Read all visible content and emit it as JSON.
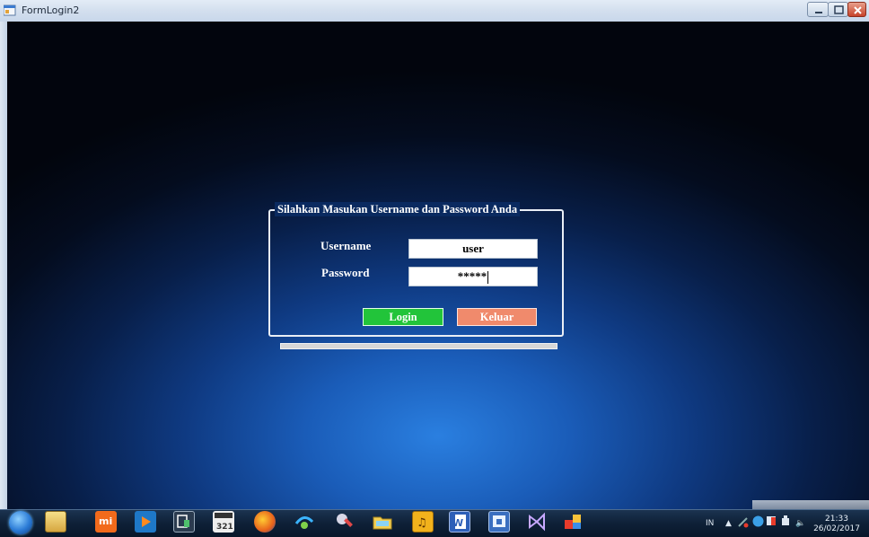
{
  "window": {
    "title": "FormLogin2",
    "icon": "form-icon",
    "controls": [
      "minimize-icon",
      "maximize-icon",
      "close-icon"
    ]
  },
  "form": {
    "group_title": "Silahkan Masukan Username dan Password Anda",
    "username_label": "Username",
    "username_value": "user",
    "password_label": "Password",
    "password_value": "*****",
    "login_button": "Login",
    "exit_button": "Keluar",
    "progress": 0
  },
  "taskbar": {
    "pinned": [
      "start-orb-icon",
      "file-explorer-icon",
      "mi-icon",
      "media-player-icon",
      "device-icon",
      "calendar-icon",
      "firefox-icon",
      "network-icon",
      "tool-icon",
      "folder-icon",
      "music-icon",
      "word-icon",
      "paint-icon",
      "visual-studio-icon",
      "app-window-icon"
    ],
    "tray_lang": "IN",
    "clock_time": "21:33",
    "clock_date": "26/02/2017"
  },
  "colors": {
    "login_button": "#22c43a",
    "exit_button": "#f08a6c",
    "desktop_glow": "#2a7fe0",
    "desktop_dark": "#02050d"
  }
}
